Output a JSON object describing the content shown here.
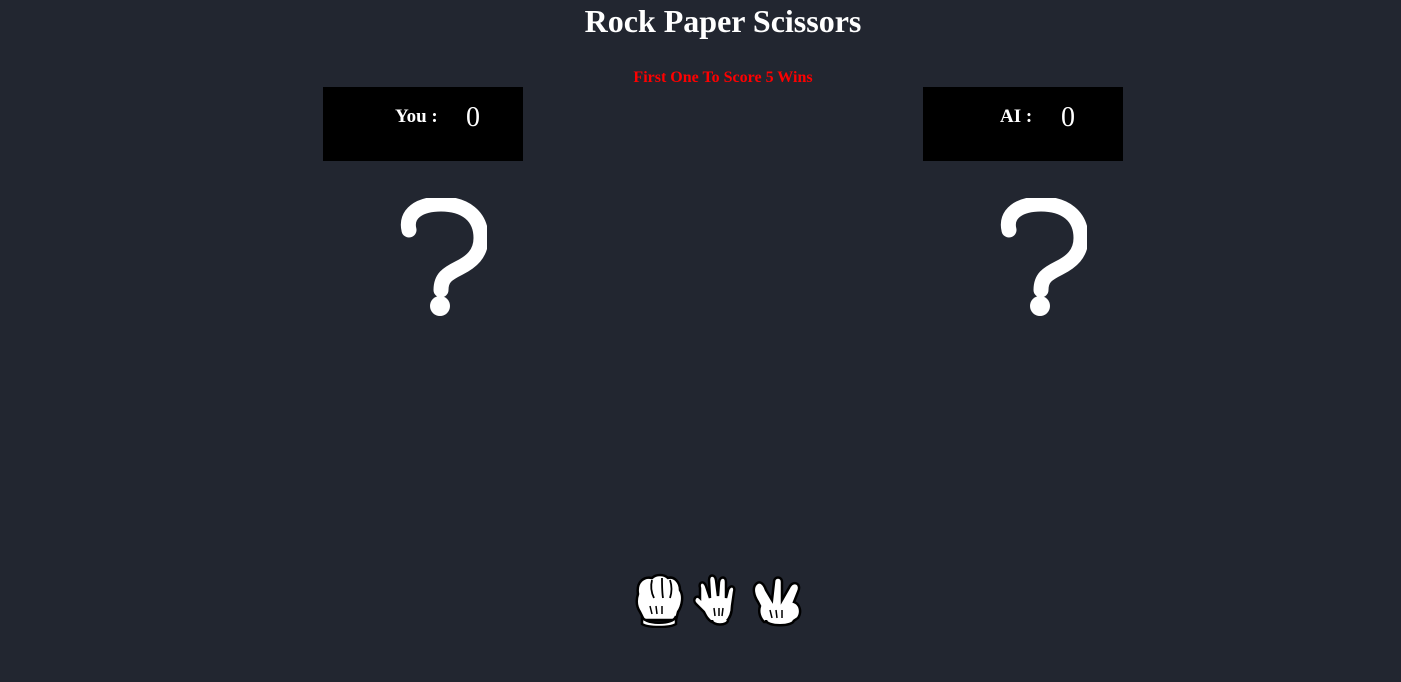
{
  "title": "Rock Paper Scissors",
  "subtitle": "First One To Score 5 Wins",
  "player": {
    "label": "You :",
    "score": "0",
    "choice_icon": "question-mark-icon"
  },
  "ai": {
    "label": "AI :",
    "score": "0",
    "choice_icon": "question-mark-icon"
  },
  "choices": [
    {
      "name": "rock",
      "icon": "rock-hand-icon"
    },
    {
      "name": "paper",
      "icon": "paper-hand-icon"
    },
    {
      "name": "scissors",
      "icon": "scissors-hand-icon"
    }
  ],
  "colors": {
    "background": "#222630",
    "scorebox": "#000000",
    "subtitle": "#ff0000",
    "text": "#ffffff"
  }
}
